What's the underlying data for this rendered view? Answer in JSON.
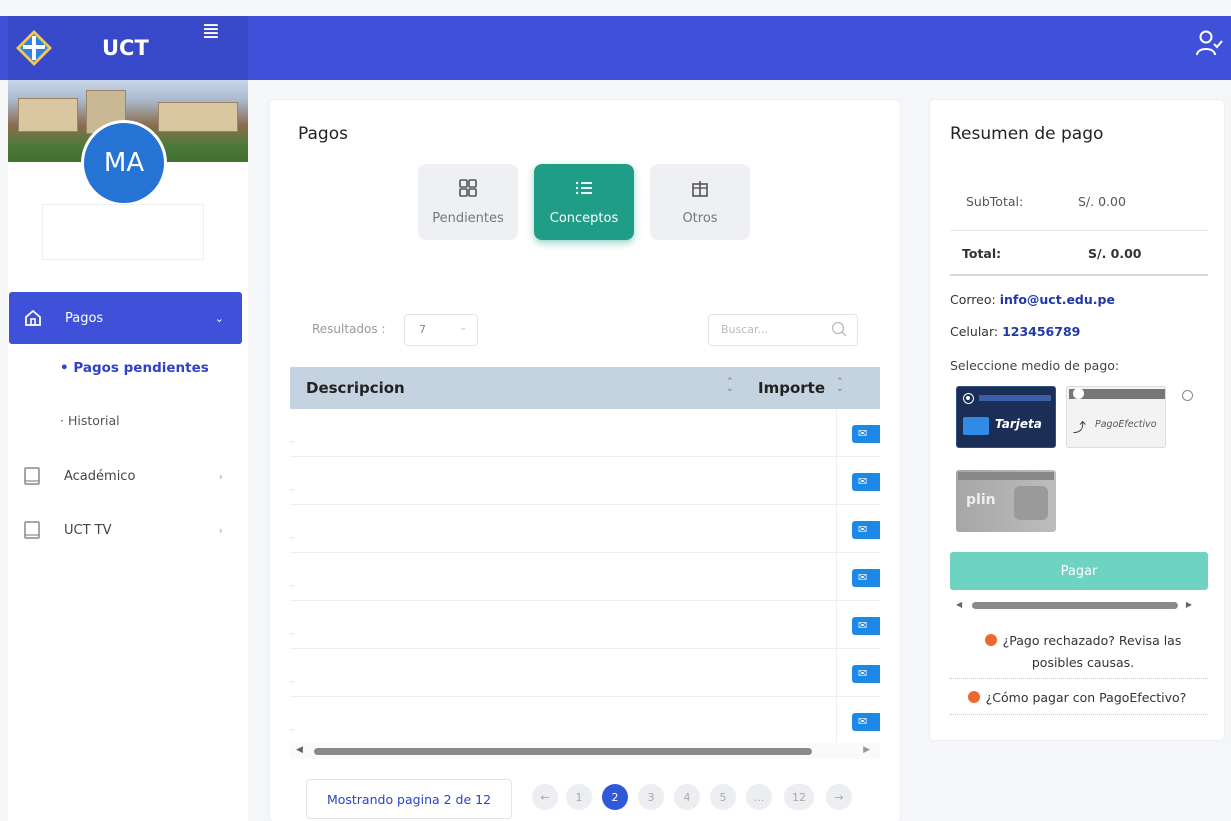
{
  "header": {
    "brand": "UCT",
    "menu_icon": "list-icon",
    "user_icon": "user-check-icon",
    "accent_color": "#3f51d9"
  },
  "profile": {
    "initials": "MA",
    "avatar_color": "#2673d6"
  },
  "sidebar": {
    "items": [
      {
        "label": "Pagos",
        "icon": "home-icon",
        "active": true
      },
      {
        "label": "Académico",
        "icon": "book-icon"
      },
      {
        "label": "UCT TV",
        "icon": "book-icon"
      }
    ],
    "sub_items": [
      {
        "label": "• Pagos pendientes",
        "active": true
      },
      {
        "label": "· Historial"
      }
    ]
  },
  "main": {
    "title": "Pagos",
    "tabs": [
      {
        "label": "Pendientes",
        "icon": "grid-icon"
      },
      {
        "label": "Conceptos",
        "icon": "list-icon",
        "active": true
      },
      {
        "label": "Otros",
        "icon": "gift-icon"
      }
    ],
    "results_label": "Resultados :",
    "results_value": "7",
    "search_placeholder": "Buscar...",
    "table": {
      "columns": [
        "Descripcion",
        "Importe"
      ],
      "row_count": 7,
      "row_button_text": "✉"
    },
    "pagination": {
      "info": "Mostrando pagina 2 de 12",
      "pages": [
        "1",
        "2",
        "3",
        "4",
        "5",
        "...",
        "12"
      ],
      "current": "2"
    }
  },
  "summary": {
    "title": "Resumen de pago",
    "subtotal_label": "SubTotal:",
    "subtotal_value": "S/. 0.00",
    "total_label": "Total:",
    "total_value": "S/. 0.00",
    "email_label": "Correo:",
    "email_value": "info@uct.edu.pe",
    "phone_label": "Celular:",
    "phone_value": "123456789",
    "method_label": "Seleccione medio de pago:",
    "methods": [
      {
        "label": "Tarjeta",
        "selected": true
      },
      {
        "label": "PagoEfectivo"
      },
      {
        "label": "plin"
      }
    ],
    "pay_button": "Pagar",
    "pay_button_color": "#6fd3c2",
    "hint_rejected": "¿Pago rechazado? Revisa las posibles causas.",
    "hint_pagoefectivo": "¿Cómo pagar con PagoEfectivo?"
  }
}
